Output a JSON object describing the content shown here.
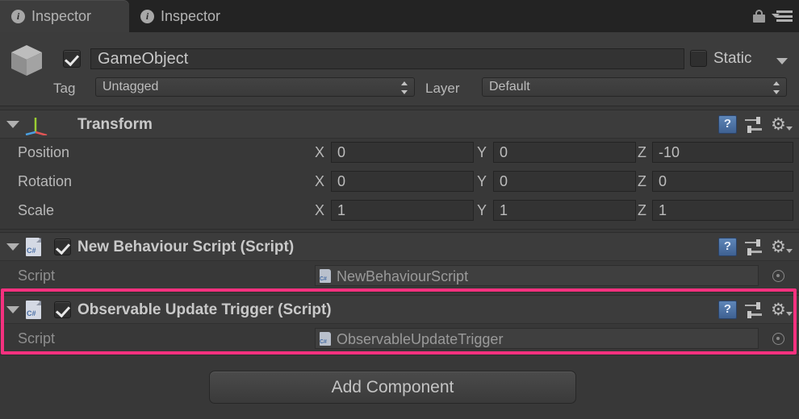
{
  "window": {
    "tabs": [
      {
        "label": "Inspector",
        "icon": "info-icon",
        "active": true
      },
      {
        "label": "Inspector",
        "icon": "info-icon",
        "active": false
      }
    ],
    "lock_icon": "lock-icon",
    "menu_icon": "hamburger-menu-icon"
  },
  "object_header": {
    "icon": "cube-icon",
    "enabled": true,
    "name": "GameObject",
    "static_checked": false,
    "static_label": "Static",
    "tag_label": "Tag",
    "tag_value": "Untagged",
    "layer_label": "Layer",
    "layer_value": "Default"
  },
  "components": [
    {
      "title": "Transform",
      "icon": "transform-axis-icon",
      "expanded": true,
      "rows": [
        {
          "name": "Position",
          "x": "0",
          "y": "0",
          "z": "-10"
        },
        {
          "name": "Rotation",
          "x": "0",
          "y": "0",
          "z": "0"
        },
        {
          "name": "Scale",
          "x": "1",
          "y": "1",
          "z": "1"
        }
      ],
      "axis_labels": {
        "x": "X",
        "y": "Y",
        "z": "Z"
      }
    },
    {
      "title": "New Behaviour Script (Script)",
      "icon": "csharp-script-icon",
      "enabled": true,
      "expanded": true,
      "script_label": "Script",
      "script_value": "NewBehaviourScript",
      "highlighted": false
    },
    {
      "title": "Observable Update Trigger (Script)",
      "icon": "csharp-script-icon",
      "enabled": true,
      "expanded": true,
      "script_label": "Script",
      "script_value": "ObservableUpdateTrigger",
      "highlighted": true
    }
  ],
  "header_icons": {
    "help": "help-book-icon",
    "preset": "preset-sliders-icon",
    "settings": "gear-icon"
  },
  "add_component": {
    "label": "Add Component"
  },
  "colors": {
    "highlight": "#f5317f",
    "panel_bg": "#383838",
    "header_bg": "#3c3c3c",
    "tabbar_bg": "#232323",
    "text": "#c4c4c4"
  }
}
